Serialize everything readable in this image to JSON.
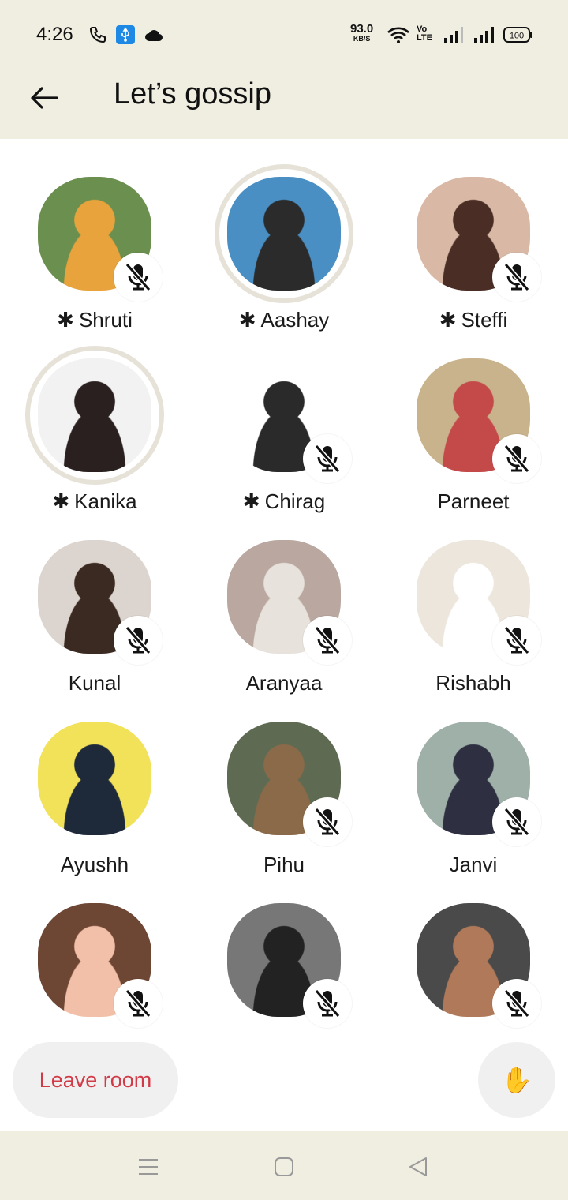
{
  "status_bar": {
    "time": "4:26",
    "speed_value": "93.0",
    "speed_unit": "KB/S",
    "volte_top": "Vo",
    "volte_bottom": "LTE",
    "battery": "100"
  },
  "header": {
    "title": "Let’s gossip",
    "back_icon": "arrow-left-icon"
  },
  "speaker_mark": "✱",
  "colors": {
    "chrome_bg": "#f0ede1",
    "leave_text": "#d13b48",
    "button_bg": "#f1f0f0",
    "speaking_ring": "#e6e2d8"
  },
  "participants": [
    {
      "name": "Shruti",
      "speaker": true,
      "muted": true,
      "speaking": false
    },
    {
      "name": "Aashay",
      "speaker": true,
      "muted": false,
      "speaking": true
    },
    {
      "name": "Steffi",
      "speaker": true,
      "muted": true,
      "speaking": false
    },
    {
      "name": "Kanika",
      "speaker": true,
      "muted": false,
      "speaking": true
    },
    {
      "name": "Chirag",
      "speaker": true,
      "muted": true,
      "speaking": false
    },
    {
      "name": "Parneet",
      "speaker": false,
      "muted": true,
      "speaking": false
    },
    {
      "name": "Kunal",
      "speaker": false,
      "muted": true,
      "speaking": false
    },
    {
      "name": "Aranyaa",
      "speaker": false,
      "muted": true,
      "speaking": false
    },
    {
      "name": "Rishabh",
      "speaker": false,
      "muted": true,
      "speaking": false
    },
    {
      "name": "Ayushh",
      "speaker": false,
      "muted": false,
      "speaking": false
    },
    {
      "name": "Pihu",
      "speaker": false,
      "muted": true,
      "speaking": false
    },
    {
      "name": "Janvi",
      "speaker": false,
      "muted": true,
      "speaking": false
    },
    {
      "name": "",
      "speaker": false,
      "muted": true,
      "speaking": false
    },
    {
      "name": "",
      "speaker": false,
      "muted": true,
      "speaking": false
    },
    {
      "name": "",
      "speaker": false,
      "muted": true,
      "speaking": false
    }
  ],
  "actions": {
    "leave_label": "Leave room",
    "raise_hand": "✋"
  }
}
